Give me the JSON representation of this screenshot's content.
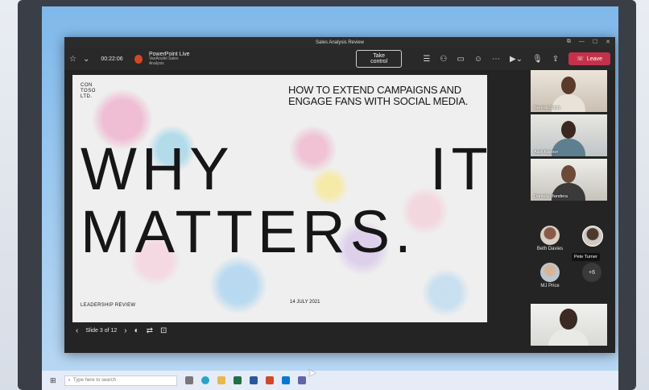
{
  "window": {
    "title": "Sales Analysis Review",
    "controls": [
      "⧉",
      "—",
      "☐",
      "✕"
    ]
  },
  "toolbar": {
    "timer": "00:22:06",
    "app_name": "PowerPoint Live",
    "file_name": "VanArsdel Sales Analysis",
    "take_control_label": "Take control",
    "leave_label": "Leave"
  },
  "slide": {
    "logo_line1": "CON",
    "logo_line2": "TOSO",
    "logo_line3": "LTD.",
    "heading_line1": "HOW TO EXTEND CAMPAIGNS AND",
    "heading_line2": "ENGAGE FANS WITH SOCIAL MEDIA.",
    "big_word1": "WHY",
    "big_word2": "IT",
    "big_word3": "MATTERS.",
    "footer_left": "LEADERSHIP REVIEW",
    "footer_date": "14 JULY 2021"
  },
  "slide_controls": {
    "counter": "Slide 3 of 12"
  },
  "participants": {
    "video": [
      {
        "name": "Serena Davis"
      },
      {
        "name": "Aadi Kapoor"
      },
      {
        "name": "Daniela Mandera"
      }
    ],
    "avatars": [
      {
        "name": "Beth Davies"
      },
      {
        "name": "Pete Turner"
      },
      {
        "name": "MJ Price"
      }
    ],
    "more_count": "+6"
  },
  "taskbar": {
    "search_placeholder": "Type here to search"
  },
  "colors": {
    "leave": "#c4314b",
    "powerpoint": "#d24726",
    "teams_bg": "#242424"
  }
}
